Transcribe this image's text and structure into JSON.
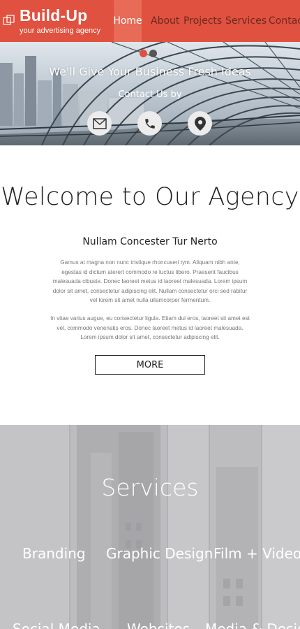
{
  "brand": {
    "name": "Build-Up",
    "tagline": "your advertising agency",
    "color": "#e0513f"
  },
  "nav": {
    "items": [
      {
        "label": "Home",
        "active": true
      },
      {
        "label": "About",
        "active": false
      },
      {
        "label": "Projects",
        "active": false
      },
      {
        "label": "Services",
        "active": false
      },
      {
        "label": "Contacts",
        "active": false
      }
    ]
  },
  "hero": {
    "title": "We'll Give Your Business Fresh Ideas",
    "subtitle": "Contact Us by",
    "slides": 2,
    "active_slide": 1,
    "contact_icons": [
      "mail-icon",
      "phone-icon",
      "location-pin-icon"
    ]
  },
  "welcome": {
    "title": "Welcome to Our Agency",
    "subtitle": "Nullam Concester Tur Nerto",
    "paragraph1": "Gamus at magna non nunc tristique rhoncuseri tym. Aliquam nibh ante, egestas id dictum aterert commodo re luctus libero. Praesent faucibus malesuada cibuste. Donec laoreet metus id laoreet malesuada. Lorem ipsum dolor sit amet, consectetur adipiscing elit. Nullam consectetur orci sed rabitur vel lorem sit amet nulla ullamcorper fermentum.",
    "paragraph2": "In vitae varius augue, eu consectetur ligula. Etiam dui eros, laoreet sit amet est vel, commodo venenatis eros. Donec laoreet metus id laoreet malesuada. Lorem ipsum dolor sit amet, consectetur adipiscing elit.",
    "more_label": "MORE"
  },
  "services": {
    "title": "Services",
    "items": [
      "Branding",
      "Graphic Design",
      "Film + Video"
    ],
    "items_row2": [
      "Social Media",
      "Websites",
      "Media & Design"
    ]
  }
}
